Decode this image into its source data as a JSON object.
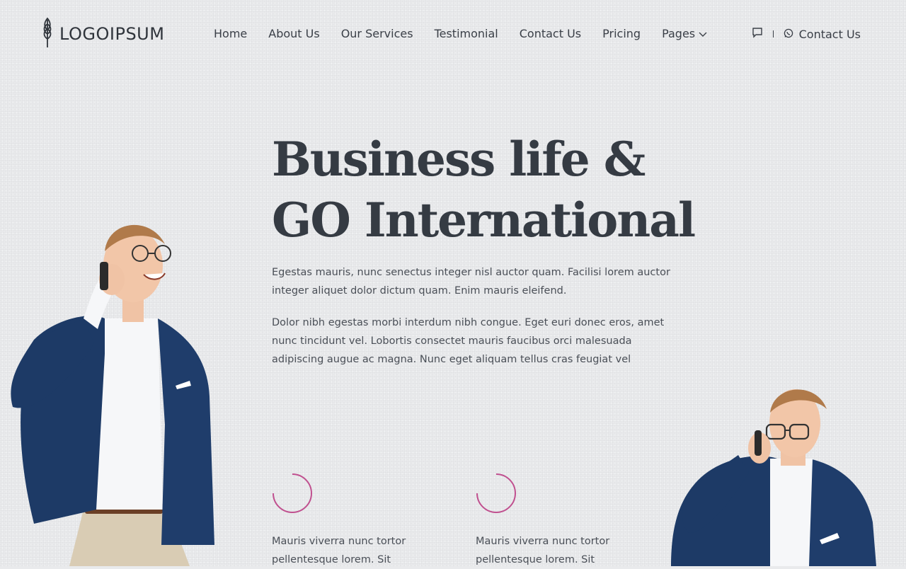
{
  "header": {
    "logo_text": "LOGOIPSUM",
    "nav": [
      "Home",
      "About Us",
      "Our Services",
      "Testimonial",
      "Contact Us",
      "Pricing",
      "Pages"
    ],
    "contact_label": "Contact Us"
  },
  "hero": {
    "title_line1": "Business life &",
    "title_line2": "GO International",
    "para1": "Egestas mauris, nunc senectus integer nisl auctor quam. Facilisi lorem auctor integer aliquet dolor dictum quam. Enim mauris eleifend.",
    "para2": "Dolor nibh egestas morbi interdum nibh congue. Eget euri donec eros, amet nunc tincidunt vel. Lobortis consectet mauris faucibus orci malesuada adipiscing augue ac magna. Nunc eget aliquam tellus cras feugiat vel"
  },
  "features": [
    {
      "text": "Mauris viverra nunc tortor pellentesque lorem. Sit"
    },
    {
      "text": "Mauris viverra nunc tortor pellentesque lorem. Sit"
    }
  ],
  "icons": {
    "logo": "wheat-leaf-icon",
    "pages_dropdown": "chevron-down-icon",
    "chat": "chat-bubble-icon",
    "whatsapp": "whatsapp-icon"
  },
  "colors": {
    "background": "#e9eaec",
    "text": "#3a3f47",
    "accent_ring": "#c0508f",
    "suit": "#1d3a66"
  }
}
